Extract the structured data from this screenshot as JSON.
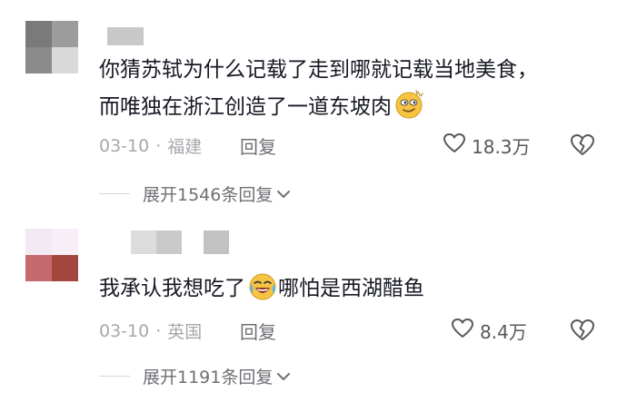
{
  "comments": [
    {
      "text_lines": [
        "你猜苏轼为什么记载了走到哪就记载当地美食，",
        "而唯独在浙江创造了一道东坡肉"
      ],
      "trailing_emoji": "smirk-face",
      "date": "03-10",
      "separator": "·",
      "location": "福建",
      "reply_label": "回复",
      "likes": "18.3万",
      "expand_label": "展开1546条回复",
      "avatar_colors": [
        "#7a7a7a",
        "#9c9c9c",
        "#8a8a8a",
        "#d9d9d9"
      ],
      "name_colors": [
        "#c8c8c8"
      ]
    },
    {
      "text_before_emoji": "我承认我想吃了",
      "inline_emoji": "crying-laugh-face",
      "text_after_emoji": "哪怕是西湖醋鱼",
      "date": "03-10",
      "separator": "·",
      "location": "英国",
      "reply_label": "回复",
      "likes": "8.4万",
      "expand_label": "展开1191条回复",
      "avatar_colors": [
        "#f3e9f3",
        "#f7eef7",
        "#c46a6f",
        "#a2463e"
      ],
      "name_colors": [
        "#dcdcdc",
        "#c9c9c9",
        "#c2c2c2"
      ]
    }
  ],
  "colors": {
    "text": "#161823",
    "meta": "#a6a8ad",
    "action": "#6e6f74",
    "emoji_yellow": "#f6c443"
  }
}
